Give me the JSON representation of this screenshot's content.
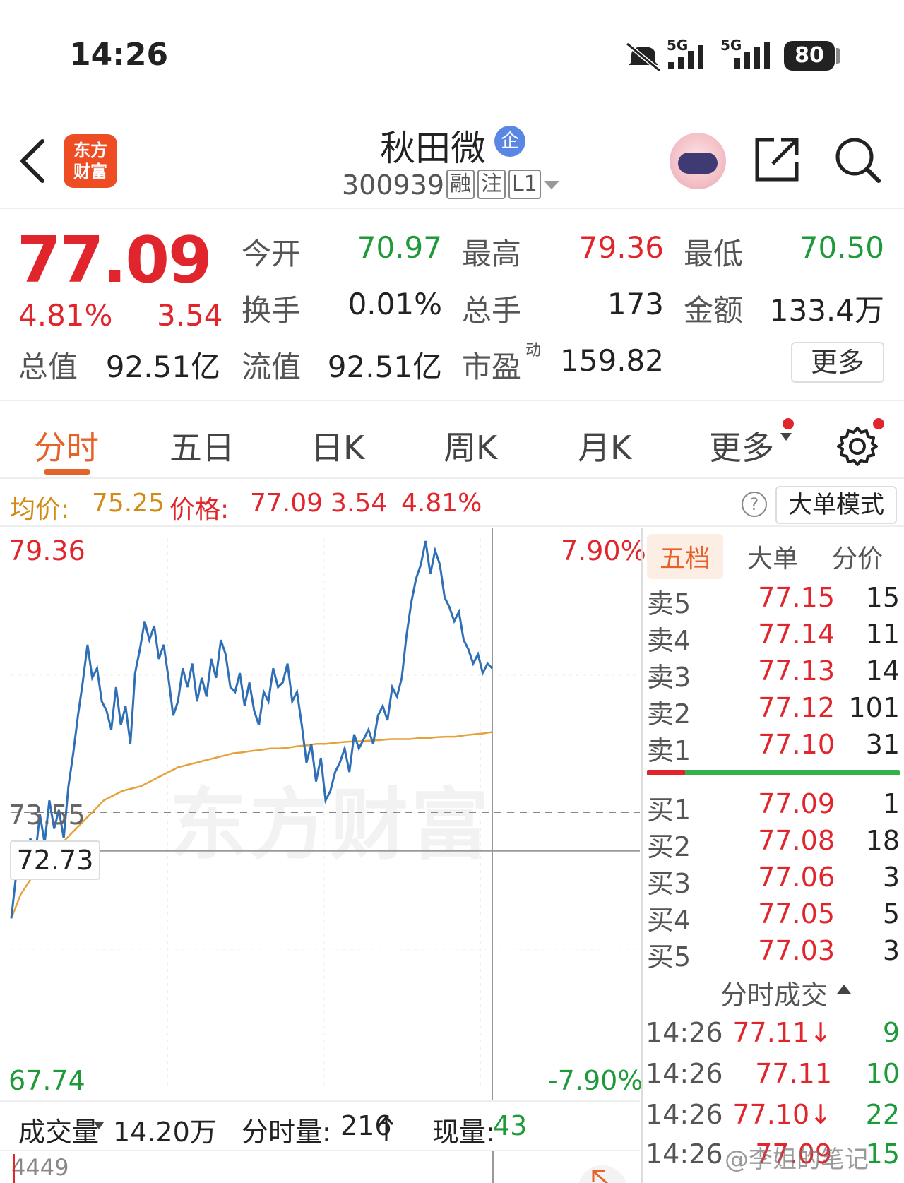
{
  "status_bar": {
    "time": "14:26",
    "network_1": "5G",
    "network_2": "5G",
    "battery": "80"
  },
  "header": {
    "app_logo_text": "东方财富",
    "stock_name": "秋田微",
    "stock_badge": "企",
    "stock_code": "300939",
    "tags": [
      "融",
      "注",
      "L1"
    ]
  },
  "quote": {
    "price": "77.09",
    "change_pct": "4.81%",
    "change": "3.54",
    "open_label": "今开",
    "open": "70.97",
    "high_label": "最高",
    "high": "79.36",
    "low_label": "最低",
    "low": "70.50",
    "turnover_label": "换手",
    "turnover": "0.01%",
    "volume_label": "总手",
    "volume": "173",
    "amount_label": "金额",
    "amount": "133.4万",
    "mktcap_label": "总值",
    "mktcap": "92.51亿",
    "float_label": "流值",
    "float_cap": "92.51亿",
    "pe_label": "市盈",
    "pe_sup": "动",
    "pe": "159.82",
    "more_button": "更多"
  },
  "tabs": [
    "分时",
    "五日",
    "日K",
    "周K",
    "月K",
    "更多"
  ],
  "info_bar": {
    "avg_label": "均价:",
    "avg": "75.25",
    "price_label": "价格:",
    "price": "77.09",
    "change": "3.54",
    "change_pct": "4.81%",
    "help": "?",
    "big_order_button": "大单模式"
  },
  "chart_labels": {
    "top_price": "79.36",
    "top_pct": "7.90%",
    "bottom_price": "67.74",
    "bottom_pct": "-7.90%",
    "prev_close": "73.55",
    "cursor_price": "72.73",
    "watermark": "东方财富"
  },
  "chart_data": {
    "type": "line",
    "ylim": [
      67.74,
      79.36
    ],
    "prev_close": 73.55,
    "series": [
      {
        "values": [
          71.3,
          72.2,
          72.6,
          72.4,
          73.0,
          72.6,
          73.5,
          72.9,
          73.8,
          73.2,
          73.6,
          73.0,
          74.1,
          74.8,
          75.6,
          76.3,
          77.1,
          76.4,
          76.6,
          75.9,
          75.7,
          75.3,
          76.2,
          75.4,
          75.8,
          75.0,
          76.5,
          77.0,
          77.6,
          77.2,
          77.5,
          76.8,
          77.1,
          76.4,
          75.6,
          75.9,
          76.6,
          76.2,
          76.7,
          75.9,
          76.4,
          76.0,
          76.8,
          76.4,
          77.2,
          76.9,
          76.2,
          76.1,
          76.5,
          75.8,
          76.3,
          75.7,
          75.4,
          76.1,
          75.9,
          76.6,
          76.2,
          76.3,
          76.7,
          75.9,
          76.1,
          75.4,
          74.6,
          75.0,
          74.2,
          74.7,
          73.8,
          74.0,
          74.4,
          74.6,
          74.9,
          74.4,
          75.2,
          74.9,
          75.1,
          75.3,
          75.0,
          75.6,
          75.8,
          75.5,
          76.2,
          76.0,
          76.4,
          77.3,
          78.0,
          78.5,
          78.8,
          79.3,
          78.6,
          79.1,
          78.8,
          78.1,
          77.9,
          77.6,
          77.8,
          77.2,
          77.0,
          76.7,
          76.9,
          76.5,
          76.7,
          76.6
        ]
      },
      {
        "values": [
          71.3,
          71.8,
          72.1,
          72.4,
          72.6,
          72.8,
          73.0,
          73.2,
          73.4,
          73.6,
          73.8,
          73.9,
          74.0,
          74.05,
          74.1,
          74.2,
          74.3,
          74.4,
          74.5,
          74.55,
          74.6,
          74.65,
          74.7,
          74.75,
          74.8,
          74.82,
          74.85,
          74.87,
          74.9,
          74.9,
          74.92,
          74.95,
          74.97,
          75.0,
          75.0,
          75.02,
          75.04,
          75.05,
          75.06,
          75.07,
          75.08,
          75.1,
          75.1,
          75.1,
          75.12,
          75.12,
          75.14,
          75.15,
          75.15,
          75.18,
          75.2,
          75.22,
          75.25
        ]
      }
    ]
  },
  "volume_bar": {
    "label": "成交量",
    "total": "14.20万",
    "minute_label": "分时量:",
    "minute": "216",
    "current_label": "现量:",
    "current": "43",
    "axis_max": "4449"
  },
  "order_book": {
    "tabs": [
      "五档",
      "大单",
      "分价"
    ],
    "asks": [
      {
        "label": "卖5",
        "price": "77.15",
        "vol": "15"
      },
      {
        "label": "卖4",
        "price": "77.14",
        "vol": "11"
      },
      {
        "label": "卖3",
        "price": "77.13",
        "vol": "14"
      },
      {
        "label": "卖2",
        "price": "77.12",
        "vol": "101"
      },
      {
        "label": "卖1",
        "price": "77.10",
        "vol": "31"
      }
    ],
    "bids": [
      {
        "label": "买1",
        "price": "77.09",
        "vol": "1"
      },
      {
        "label": "买2",
        "price": "77.08",
        "vol": "18"
      },
      {
        "label": "买3",
        "price": "77.06",
        "vol": "3"
      },
      {
        "label": "买4",
        "price": "77.05",
        "vol": "5"
      },
      {
        "label": "买5",
        "price": "77.03",
        "vol": "3"
      }
    ],
    "ticks_title": "分时成交",
    "ticks": [
      {
        "time": "14:26",
        "price": "77.11↓",
        "vol": "9"
      },
      {
        "time": "14:26",
        "price": "77.11",
        "vol": "10"
      },
      {
        "time": "14:26",
        "price": "77.10↓",
        "vol": "22"
      },
      {
        "time": "14:26",
        "price": "77.09",
        "vol": "15"
      }
    ]
  },
  "footer_watermark": "@李姐的笔记"
}
